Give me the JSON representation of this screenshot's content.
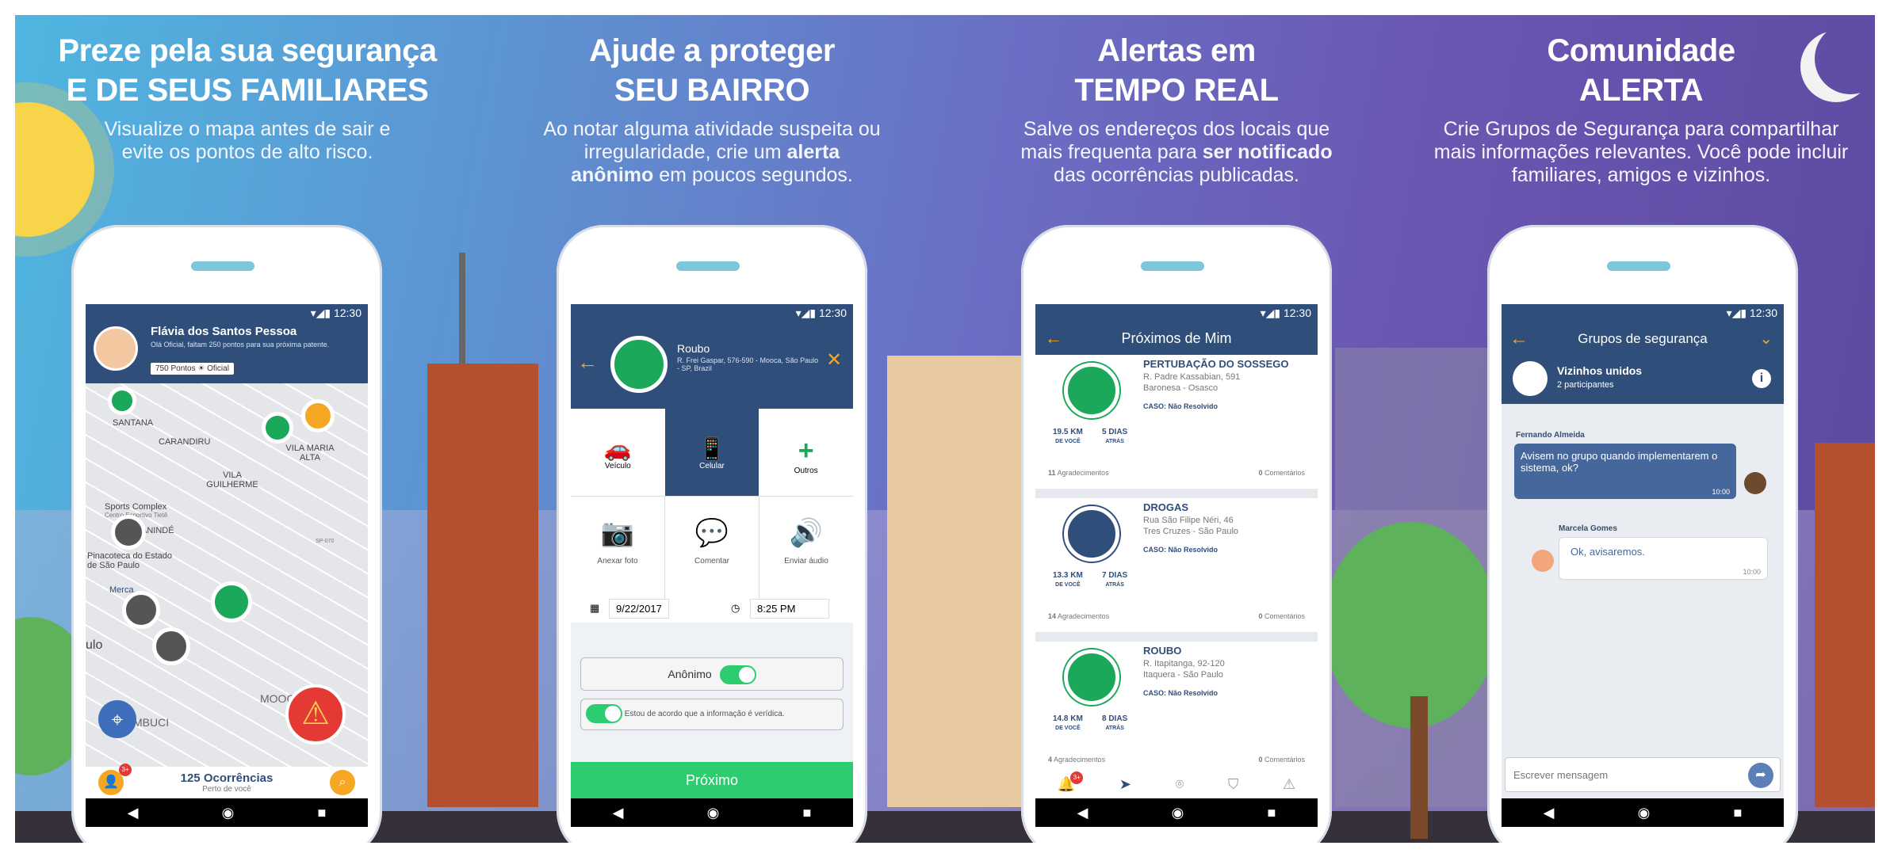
{
  "panels": [
    {
      "title1": "Preze pela sua segurança",
      "title2": "E DE SEUS FAMILIARES",
      "desc": "Visualize o mapa antes de sair e evite os pontos de alto risco."
    },
    {
      "title1": "Ajude a proteger",
      "title2": "SEU BAIRRO",
      "desc_a": "Ao notar alguma atividade suspeita ou irregularidade, crie um ",
      "desc_b": "alerta anônimo",
      "desc_c": " em poucos segundos."
    },
    {
      "title1": "Alertas em",
      "title2": "TEMPO REAL",
      "desc_a": "Salve os endereços dos locais que mais frequenta para ",
      "desc_b": "ser notificado",
      "desc_c": " das ocorrências publicadas."
    },
    {
      "title1": "Comunidade",
      "title2": "ALERTA",
      "desc": "Crie Grupos de Segurança para compartilhar mais informações relevantes. Você pode incluir familiares, amigos e vizinhos."
    }
  ],
  "status_time": "12:30",
  "screen1": {
    "name": "Flávia dos Santos Pessoa",
    "sub": "Olá Oficial, faltam 250 pontos para sua próxima patente.",
    "points": "750 Pontos",
    "rank": "Oficial",
    "map_labels": [
      "SANTANA",
      "CARANDIRU",
      "VILA MARIA ALTA",
      "VILA GUILHERME",
      "Sports Complex",
      "Centro Esportivo Tietê",
      "ANINDÉ",
      "Pinacoteca do Estado de São Paulo",
      "Merca...",
      "ulo",
      "MOOC",
      "MBUCI",
      "SP-070"
    ],
    "occurrences": "125 Ocorrências",
    "near": "Perto de você",
    "badge": "3+"
  },
  "screen2": {
    "type": "Roubo",
    "address": "R. Frei Gaspar, 576-590 - Mooca, São Paulo - SP, Brazil",
    "options": [
      "Veículo",
      "Celular",
      "Outros"
    ],
    "actions": [
      "Anexar foto",
      "Comentar",
      "Enviar áudio"
    ],
    "date": "9/22/2017",
    "time": "8:25 PM",
    "anon": "Anônimo",
    "agree": "Estou de acordo que a informação é verídica.",
    "next": "Próximo"
  },
  "screen3": {
    "title": "Próximos de Mim",
    "items": [
      {
        "type": "PERTUBAÇÃO DO SOSSEGO",
        "addr1": "R. Padre Kassabian, 591",
        "addr2": "Baronesa - Osasco",
        "status": "CASO: Não Resolvido",
        "dist": "19.5 KM",
        "dist_l": "DE VOCÊ",
        "days": "5 DIAS",
        "days_l": "ATRÁS",
        "likes": "11",
        "likes_l": "Agradecimentos",
        "comments": "0",
        "comments_l": "Comentários"
      },
      {
        "type": "DROGAS",
        "addr1": "Rua São Filipe Néri, 46",
        "addr2": "Tres Cruzes - São Paulo",
        "status": "CASO: Não Resolvido",
        "dist": "13.3 KM",
        "dist_l": "DE VOCÊ",
        "days": "7 DIAS",
        "days_l": "ATRÁS",
        "likes": "14",
        "likes_l": "Agradecimentos",
        "comments": "0",
        "comments_l": "Comentários"
      },
      {
        "type": "ROUBO",
        "addr1": "R. Itapitanga, 92-120",
        "addr2": "Itaquera - São Paulo",
        "status": "CASO: Não Resolvido",
        "dist": "14.8 KM",
        "dist_l": "DE VOCÊ",
        "days": "8 DIAS",
        "days_l": "ATRÁS",
        "likes": "4",
        "likes_l": "Agradecimentos",
        "comments": "0",
        "comments_l": "Comentários"
      }
    ],
    "badge": "3+"
  },
  "screen4": {
    "title": "Grupos de segurança",
    "group": "Vizinhos unidos",
    "participants": "2 participantes",
    "msg1_author": "Fernando Almeida",
    "msg1": "Avisem no grupo quando implementarem o sistema, ok?",
    "msg1_time": "10:00",
    "msg2_author": "Marcela Gomes",
    "msg2": "Ok, avisaremos.",
    "msg2_time": "10:00",
    "input_placeholder": "Escrever mensagem"
  },
  "colors": {
    "primary": "#2f4e7a",
    "green": "#1ba85a",
    "bright_green": "#2ecc71",
    "orange": "#f5a623",
    "red": "#e53935"
  }
}
